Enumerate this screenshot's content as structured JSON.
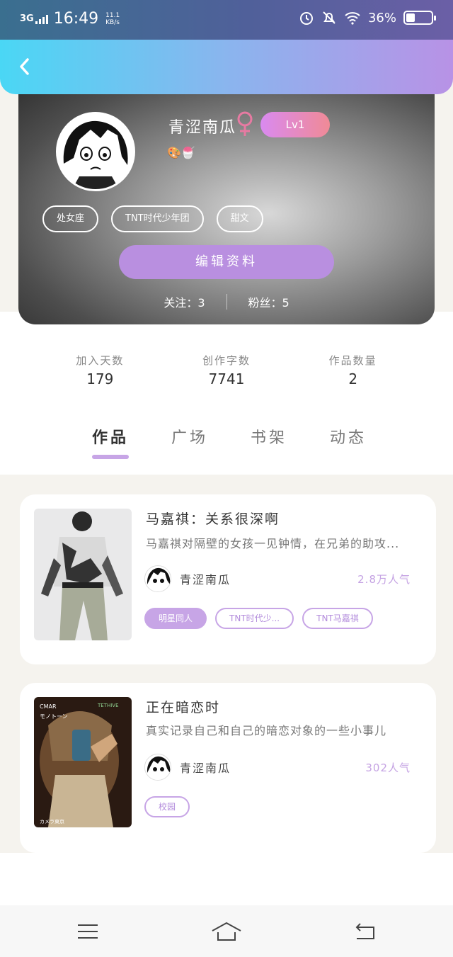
{
  "status_bar": {
    "network": "3G",
    "time": "16:49",
    "speed_value": "11.1",
    "speed_unit": "KB/s",
    "battery_percent": "36%",
    "battery_level": 0.36
  },
  "profile": {
    "username": "青涩南瓜",
    "level": "Lv1",
    "emoji": "🎨🍧",
    "tags": [
      "处女座",
      "TNT时代少年团",
      "甜文"
    ],
    "edit_button": "编辑资料",
    "following": "关注：3",
    "followers": "粉丝：5"
  },
  "stats": [
    {
      "label": "加入天数",
      "value": "179"
    },
    {
      "label": "创作字数",
      "value": "7741"
    },
    {
      "label": "作品数量",
      "value": "2"
    }
  ],
  "tabs": [
    "作品",
    "广场",
    "书架",
    "动态"
  ],
  "works": [
    {
      "title": "马嘉祺：关系很深啊",
      "description": "马嘉祺对隔壁的女孩一见钟情，在兄弟的助攻...",
      "author": "青涩南瓜",
      "popularity": "2.8万人气",
      "tags": [
        "明星同人",
        "TNT时代少...",
        "TNT马嘉祺"
      ]
    },
    {
      "title": "正在暗恋时",
      "description": "真实记录自己和自己的暗恋对象的一些小事儿",
      "author": "青涩南瓜",
      "popularity": "302人气",
      "tags": [
        "校园"
      ],
      "cover_texts": [
        "CMAR",
        "モノトーン",
        "カメラ東京",
        "TETHIVE"
      ]
    }
  ],
  "colors": {
    "accent": "#c7a5e6",
    "header_start": "#4ad7f5",
    "header_end": "#b892e6"
  },
  "icons": {
    "back": "chevron-left-icon",
    "gender": "female-icon",
    "nav_menu": "menu-icon",
    "nav_home": "home-icon",
    "nav_back": "back-icon"
  }
}
